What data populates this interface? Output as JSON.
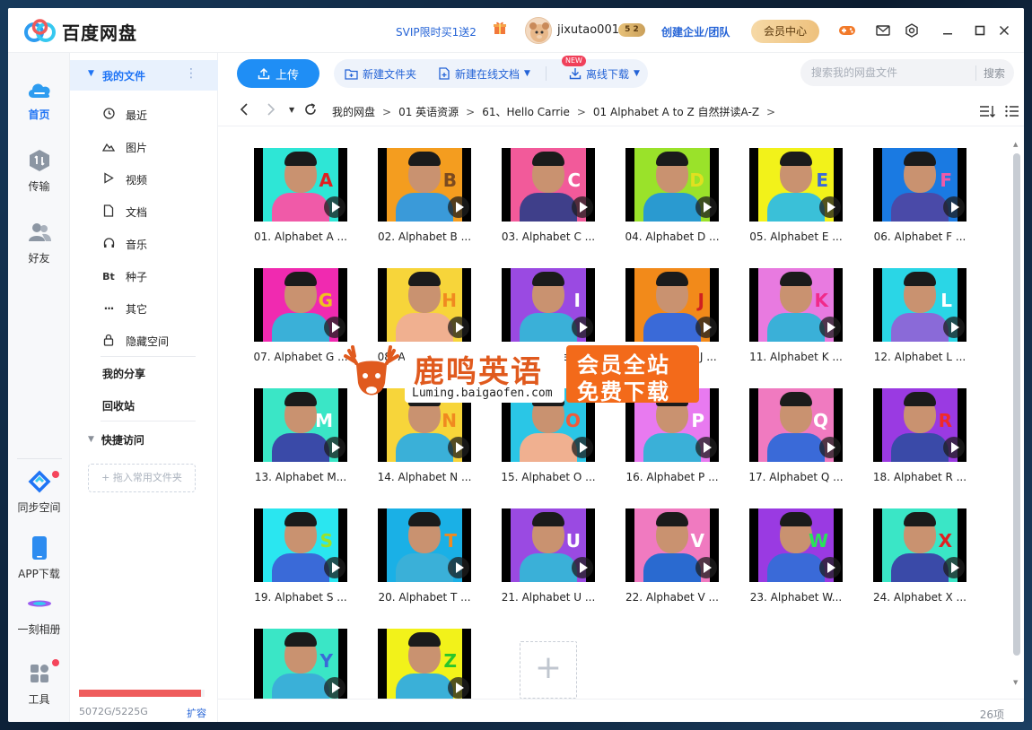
{
  "app": {
    "name": "百度网盘",
    "svip_promo": "SVIP限时买1送2",
    "username": "jixutao001",
    "vip_level": "5 2",
    "enterprise": "创建企业/团队",
    "member_center": "会员中心"
  },
  "rail": {
    "items": [
      {
        "label": "首页"
      },
      {
        "label": "传输"
      },
      {
        "label": "好友"
      }
    ],
    "bottom": [
      {
        "label": "同步空间"
      },
      {
        "label": "APP下载"
      },
      {
        "label": "一刻相册"
      },
      {
        "label": "工具"
      }
    ]
  },
  "sidebar": {
    "my_files": "我的文件",
    "items": [
      {
        "label": "最近",
        "icon": "clock-icon"
      },
      {
        "label": "图片",
        "icon": "image-icon"
      },
      {
        "label": "视频",
        "icon": "play-icon"
      },
      {
        "label": "文档",
        "icon": "document-icon"
      },
      {
        "label": "音乐",
        "icon": "headphones-icon"
      },
      {
        "label": "种子",
        "icon": "torrent-icon"
      },
      {
        "label": "其它",
        "icon": "more-icon"
      },
      {
        "label": "隐藏空间",
        "icon": "lock-icon"
      }
    ],
    "my_share": "我的分享",
    "recycle": "回收站",
    "quick_access": "快捷访问",
    "drop_hint": "+ 拖入常用文件夹",
    "quota_text": "5072G/5225G",
    "quota_fraction": 0.97,
    "expand": "扩容"
  },
  "toolbar": {
    "upload": "上传",
    "new_folder": "新建文件夹",
    "new_online_doc": "新建在线文档",
    "new_badge": "NEW",
    "offline_download": "离线下载",
    "search_placeholder": "搜索我的网盘文件",
    "search_button": "搜索"
  },
  "breadcrumb": [
    "我的网盘",
    "01 英语资源",
    "61、Hello Carrie",
    "01 Alphabet A to Z 自然拼读A-Z"
  ],
  "files": [
    {
      "name": "01. Alphabet A ...",
      "bg": "#2ee6d6",
      "shirt": "#f05aa8",
      "letter": "A",
      "lc": "#e02020"
    },
    {
      "name": "02. Alphabet B ...",
      "bg": "#f49d1f",
      "shirt": "#3a9ad9",
      "letter": "B",
      "lc": "#7a4a20"
    },
    {
      "name": "03. Alphabet C ...",
      "bg": "#f25a9a",
      "shirt": "#3f3f8a",
      "letter": "C",
      "lc": "#ffffff"
    },
    {
      "name": "04. Alphabet D ...",
      "bg": "#9ae22a",
      "shirt": "#2a9ad0",
      "letter": "D",
      "lc": "#e0e020"
    },
    {
      "name": "05. Alphabet E ...",
      "bg": "#f2f21a",
      "shirt": "#3ac0d8",
      "letter": "E",
      "lc": "#3a6ad8"
    },
    {
      "name": "06. Alphabet F ...",
      "bg": "#1a7ae2",
      "shirt": "#4a4aa8",
      "letter": "F",
      "lc": "#f05aa8"
    },
    {
      "name": "07. Alphabet G ...",
      "bg": "#f02ab0",
      "shirt": "#3ab0d8",
      "letter": "G",
      "lc": "#f0c020"
    },
    {
      "name": "08. Alphabet H ...",
      "bg": "#f7d53a",
      "shirt": "#f0b090",
      "letter": "H",
      "lc": "#f08a20"
    },
    {
      "name": "09. Alphabet I ...",
      "bg": "#9a4ae2",
      "shirt": "#3ab0d8",
      "letter": "I",
      "lc": "#ffffff"
    },
    {
      "name": "10. Alphabet J ...",
      "bg": "#f28a1a",
      "shirt": "#3a6ad8",
      "letter": "J",
      "lc": "#d02020"
    },
    {
      "name": "11. Alphabet K ...",
      "bg": "#e87ae0",
      "shirt": "#3ab0d8",
      "letter": "K",
      "lc": "#f02a8a"
    },
    {
      "name": "12. Alphabet L ...",
      "bg": "#2ad6e6",
      "shirt": "#8a6ad8",
      "letter": "L",
      "lc": "#ffffff"
    },
    {
      "name": "13. Alphabet M...",
      "bg": "#3ae6c6",
      "shirt": "#3a4aa8",
      "letter": "M",
      "lc": "#ffffff"
    },
    {
      "name": "14. Alphabet N ...",
      "bg": "#f7d53a",
      "shirt": "#3ab0d8",
      "letter": "N",
      "lc": "#f08a20"
    },
    {
      "name": "15. Alphabet O ...",
      "bg": "#2ac6e6",
      "shirt": "#f0b090",
      "letter": "O",
      "lc": "#f05a3a"
    },
    {
      "name": "16. Alphabet P ...",
      "bg": "#e87af0",
      "shirt": "#3ab0d8",
      "letter": "P",
      "lc": "#ffffff"
    },
    {
      "name": "17. Alphabet Q ...",
      "bg": "#f07ac0",
      "shirt": "#3a6ad8",
      "letter": "Q",
      "lc": "#ffffff"
    },
    {
      "name": "18. Alphabet R ...",
      "bg": "#9a3ae2",
      "shirt": "#3a4aa8",
      "letter": "R",
      "lc": "#f02a2a"
    },
    {
      "name": "19. Alphabet S ...",
      "bg": "#2ae6f0",
      "shirt": "#3a6ad8",
      "letter": "S",
      "lc": "#9ae22a"
    },
    {
      "name": "20. Alphabet T ...",
      "bg": "#1ab0e6",
      "shirt": "#3ab0d8",
      "letter": "T",
      "lc": "#f08a20"
    },
    {
      "name": "21. Alphabet U ...",
      "bg": "#9a4ae2",
      "shirt": "#3ab0d8",
      "letter": "U",
      "lc": "#ffffff"
    },
    {
      "name": "22. Alphabet V ...",
      "bg": "#f07ac0",
      "shirt": "#2a6ad0",
      "letter": "V",
      "lc": "#ffffff"
    },
    {
      "name": "23. Alphabet W...",
      "bg": "#9a3ae2",
      "shirt": "#3a6ad8",
      "letter": "W",
      "lc": "#2ae25a"
    },
    {
      "name": "24. Alphabet X ...",
      "bg": "#3ae6c6",
      "shirt": "#3a4aa8",
      "letter": "X",
      "lc": "#e02020"
    },
    {
      "name": "",
      "bg": "#3ae6c6",
      "shirt": "#3ab0d8",
      "letter": "Y",
      "lc": "#3a6ad8"
    },
    {
      "name": "",
      "bg": "#f2f21a",
      "shirt": "#3ab0d8",
      "letter": "Z",
      "lc": "#2ac62a"
    }
  ],
  "status": {
    "count": "26项"
  },
  "watermark": {
    "title": "鹿鸣英语",
    "url": "Luming.baigaofen.com",
    "line1": "会员全站",
    "line2": "免费下载"
  },
  "colors": {
    "accent": "#1f8ef5",
    "link": "#2463d6",
    "sidebar_active": "#e8f1fd",
    "quota": "#ef5c5c"
  }
}
